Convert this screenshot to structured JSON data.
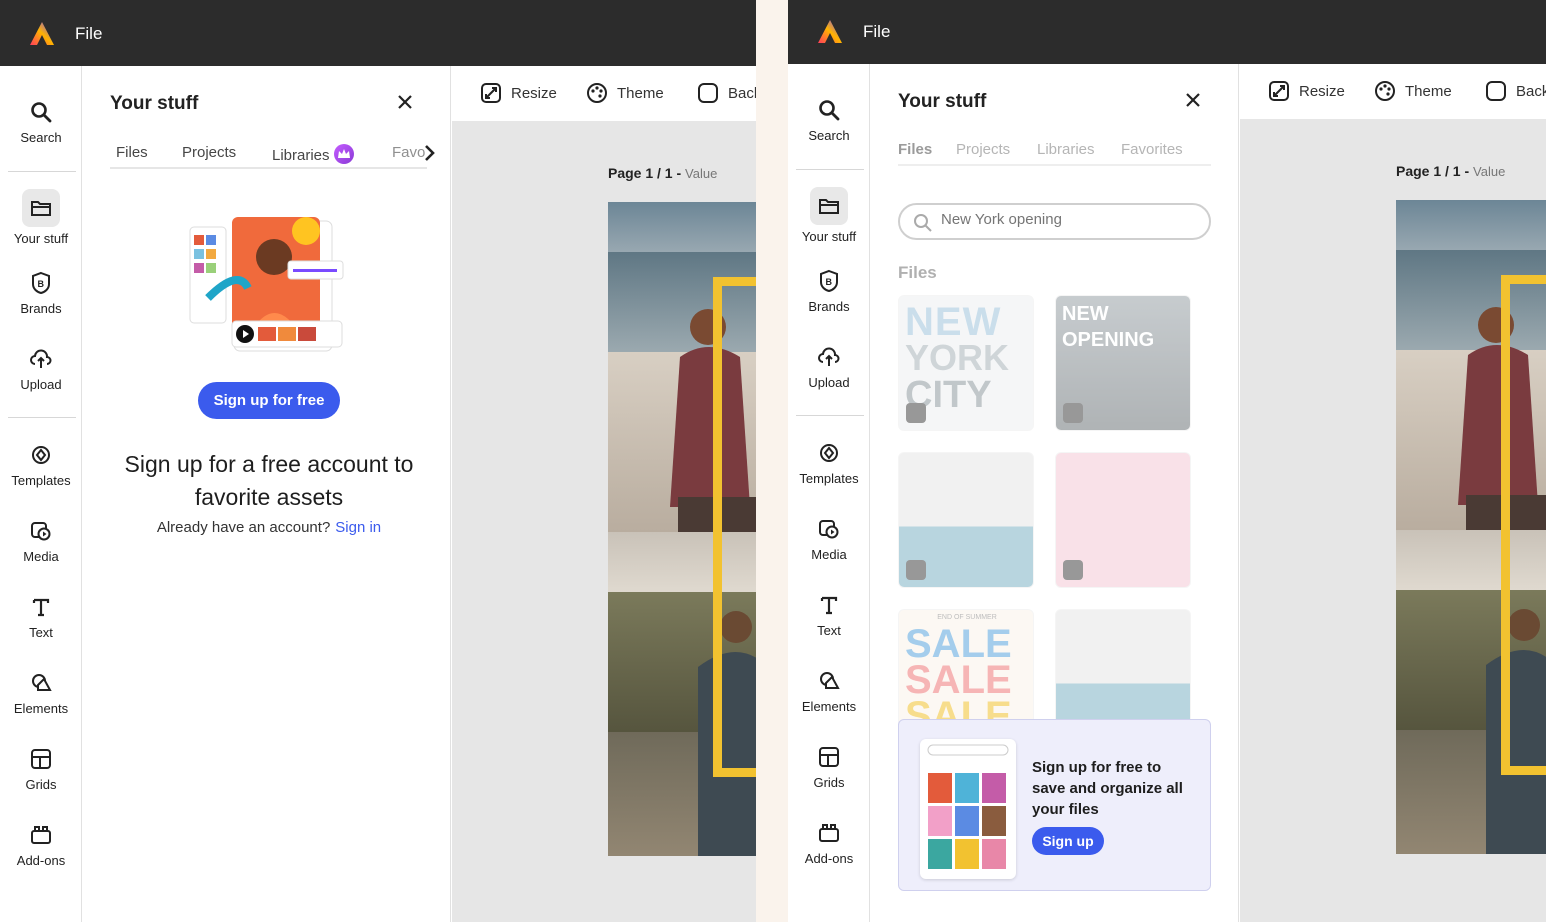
{
  "colors": {
    "accent": "#3b5bed",
    "topbar": "#2c2c2c",
    "frame": "#f2c230",
    "premium": "#a64ae6"
  },
  "left": {
    "app_menu": "File",
    "rail": {
      "search": "Search",
      "your_stuff": "Your stuff",
      "brands": "Brands",
      "upload": "Upload",
      "templates": "Templates",
      "media": "Media",
      "text": "Text",
      "elements": "Elements",
      "grids": "Grids",
      "addons": "Add-ons"
    },
    "drawer": {
      "title": "Your stuff",
      "tabs": [
        "Files",
        "Projects",
        "Libraries",
        "Favo"
      ],
      "signup_button": "Sign up for free",
      "heading": "Sign up for a free account to favorite assets",
      "have_account": "Already have an account?",
      "sign_in": "Sign in"
    },
    "toolbar": {
      "resize": "Resize",
      "theme": "Theme",
      "back": "Back"
    },
    "page": {
      "label": "Page 1 / 1 -",
      "value": "Value"
    }
  },
  "right": {
    "app_menu": "File",
    "rail": {
      "search": "Search",
      "your_stuff": "Your stuff",
      "brands": "Brands",
      "upload": "Upload",
      "templates": "Templates",
      "media": "Media",
      "text": "Text",
      "elements": "Elements",
      "grids": "Grids",
      "addons": "Add-ons"
    },
    "drawer": {
      "title": "Your stuff",
      "tabs": [
        "Files",
        "Projects",
        "Libraries",
        "Favorites"
      ],
      "search_placeholder": "New York opening",
      "files_heading": "Files",
      "thumbs": {
        "nyc": [
          "NEW",
          "YORK",
          "CITY"
        ],
        "opening": [
          "NEW",
          "OPENING"
        ],
        "sale_top": "END OF SUMMER",
        "sale": [
          "SALE",
          "SALE",
          "SALE"
        ]
      },
      "card_text": "Sign up for free to save and organize all your files",
      "card_button": "Sign up"
    },
    "toolbar": {
      "resize": "Resize",
      "theme": "Theme",
      "back": "Back"
    },
    "page": {
      "label": "Page 1 / 1 -",
      "value": "Value"
    }
  }
}
